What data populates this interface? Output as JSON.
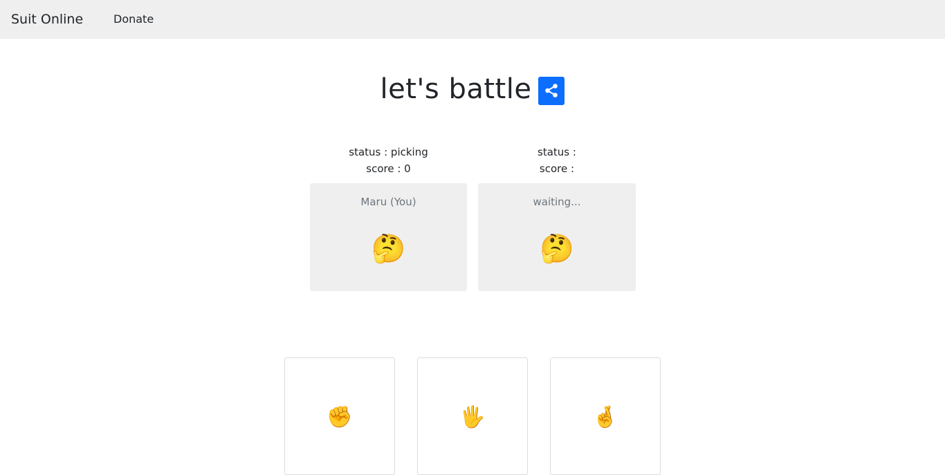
{
  "navbar": {
    "brand": "Suit Online",
    "links": [
      {
        "label": "Donate"
      }
    ]
  },
  "main": {
    "title": "let's battle",
    "share_icon": "share-icon",
    "share_color": "#0d6efd"
  },
  "players": [
    {
      "status_line": "status : picking",
      "score_line": "score : 0",
      "name": "Maru (You)",
      "emoji": "🤔"
    },
    {
      "status_line": "status :",
      "score_line": "score :",
      "name": "waiting...",
      "emoji": "🤔"
    }
  ],
  "choices": [
    {
      "name": "rock",
      "emoji": "✊"
    },
    {
      "name": "paper",
      "emoji": "🖐"
    },
    {
      "name": "scissors",
      "emoji": "🤞"
    }
  ],
  "colors": {
    "navbar_bg": "#efefef",
    "card_bg": "#efefef",
    "muted_text": "#6c757d",
    "primary": "#0d6efd"
  }
}
